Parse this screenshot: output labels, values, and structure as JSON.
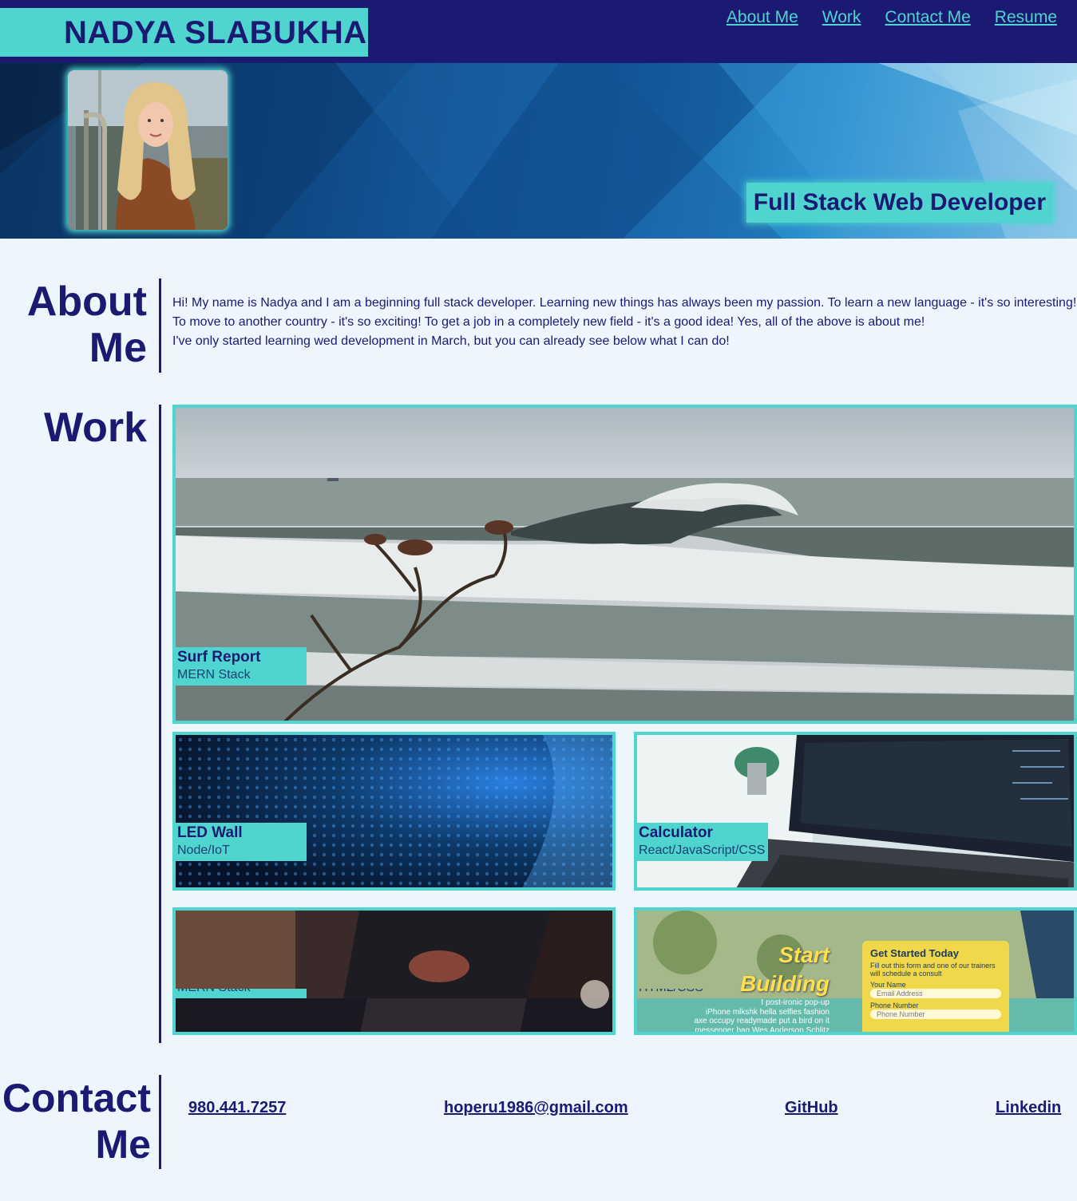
{
  "header": {
    "name": "NADYA SLABUKHA",
    "nav": [
      "About Me",
      "Work",
      "Contact Me",
      "Resume"
    ]
  },
  "hero": {
    "subtitle": "Full Stack Web Developer"
  },
  "about": {
    "title_line1": "About",
    "title_line2": "Me",
    "paragraphs": [
      "Hi! My name is Nadya and I am a beginning full stack developer. Learning new things has always been my passion. To learn a new language - it's so interesting!",
      "To move to another country - it's so exciting! To get a job in a completely new field - it's a good idea! Yes, all of the above is about me!",
      "I've only started learning wed development in March, but you can already see below what I can do!"
    ]
  },
  "work": {
    "title": "Work",
    "projects": [
      {
        "title": "Surf Report",
        "stack": "MERN Stack"
      },
      {
        "title": "LED Wall",
        "stack": "Node/IoT"
      },
      {
        "title": "Calculator",
        "stack": "React/JavaScript/CSS"
      },
      {
        "title": "",
        "stack": "MERN Stack"
      },
      {
        "title": "",
        "stack": "HTML/CSS"
      }
    ],
    "fitness_card": {
      "headline1": "Start",
      "headline2": "Building",
      "form_title": "Get Started Today",
      "form_desc1": "Fill out this form and one of our trainers",
      "form_desc2": "will schedule a consult",
      "label_name": "Your Name",
      "placeholder_email": "Email Address",
      "label_phone": "Phone Number",
      "placeholder_phone": "Phone Number",
      "lorem1": "I post-ironic pop-up",
      "lorem2": "iPhone mlkshk hella selfies fashion",
      "lorem3": "axe occupy readymade put a bird on it",
      "lorem4": "messenger bag Wes Anderson Schlitz"
    }
  },
  "contact": {
    "title_line1": "Contact",
    "title_line2": "Me",
    "phone": "980.441.7257",
    "email": "hoperu1986@gmail.com",
    "github": "GitHub",
    "linkedin": "Linkedin"
  },
  "colors": {
    "navy": "#1b1a72",
    "teal": "#4fd4cf",
    "background": "#eef6fd"
  }
}
